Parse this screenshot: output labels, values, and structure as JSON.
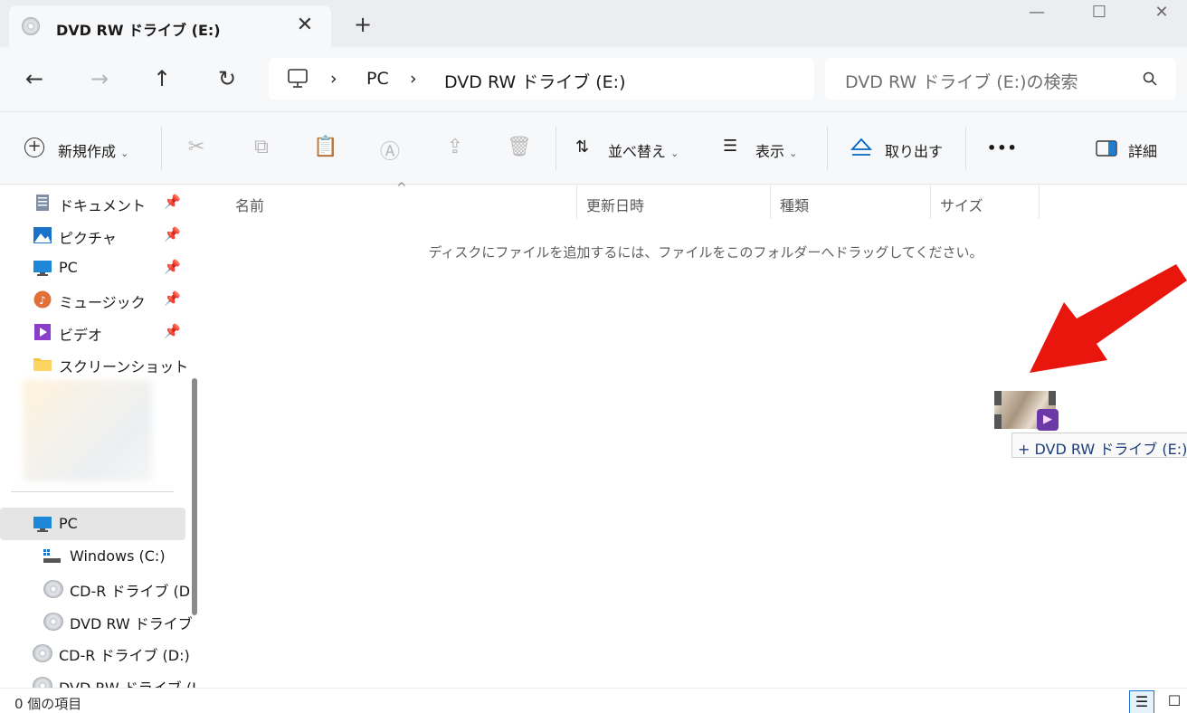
{
  "window": {
    "tab_title": "DVD RW ドライブ (E:)",
    "tab_close": "✕",
    "new_tab": "+",
    "minimize": "—",
    "maximize": "☐",
    "close": "✕"
  },
  "nav": {
    "back": "←",
    "forward": "→",
    "up": "↑",
    "refresh": "↻",
    "breadcrumb": [
      "PC",
      "DVD RW ドライブ (E:)"
    ],
    "breadcrumb_sep": "›",
    "search_placeholder": "DVD RW ドライブ (E:)の検索"
  },
  "toolbar": {
    "new_label": "新規作成",
    "sort_label": "並べ替え",
    "view_label": "表示",
    "eject_label": "取り出す",
    "more_label": "•••",
    "details_label": "詳細",
    "chevron": "⌄"
  },
  "sidebar": {
    "pinned": [
      {
        "label": "ドキュメント",
        "icon": "document-icon"
      },
      {
        "label": "ピクチャ",
        "icon": "pictures-icon"
      },
      {
        "label": "PC",
        "icon": "pc-icon"
      },
      {
        "label": "ミュージック",
        "icon": "music-icon"
      },
      {
        "label": "ビデオ",
        "icon": "video-icon"
      }
    ],
    "folder": {
      "label": "スクリーンショット",
      "icon": "folder-icon"
    },
    "pc_section": {
      "label": "PC",
      "icon": "pc-icon"
    },
    "drives": [
      {
        "label": "Windows (C:)",
        "icon": "drive-icon"
      },
      {
        "label": "CD-R ドライブ (D:",
        "icon": "disc-icon"
      },
      {
        "label": "DVD RW ドライブ",
        "icon": "disc-icon"
      },
      {
        "label": "CD-R ドライブ (D:)",
        "icon": "disc-icon"
      },
      {
        "label": "DVD RW ドライブ (I",
        "icon": "disc-icon"
      }
    ]
  },
  "content": {
    "columns": [
      "名前",
      "更新日時",
      "種類",
      "サイズ"
    ],
    "empty_message": "ディスクにファイルを追加するには、ファイルをこのフォルダーへドラッグしてください。"
  },
  "drag": {
    "tooltip": "+ DVD RW ドライブ (E:) へ"
  },
  "status": {
    "item_count": "0 個の項目"
  },
  "colors": {
    "accent": "#0067c0",
    "arrow": "#e8160c"
  }
}
